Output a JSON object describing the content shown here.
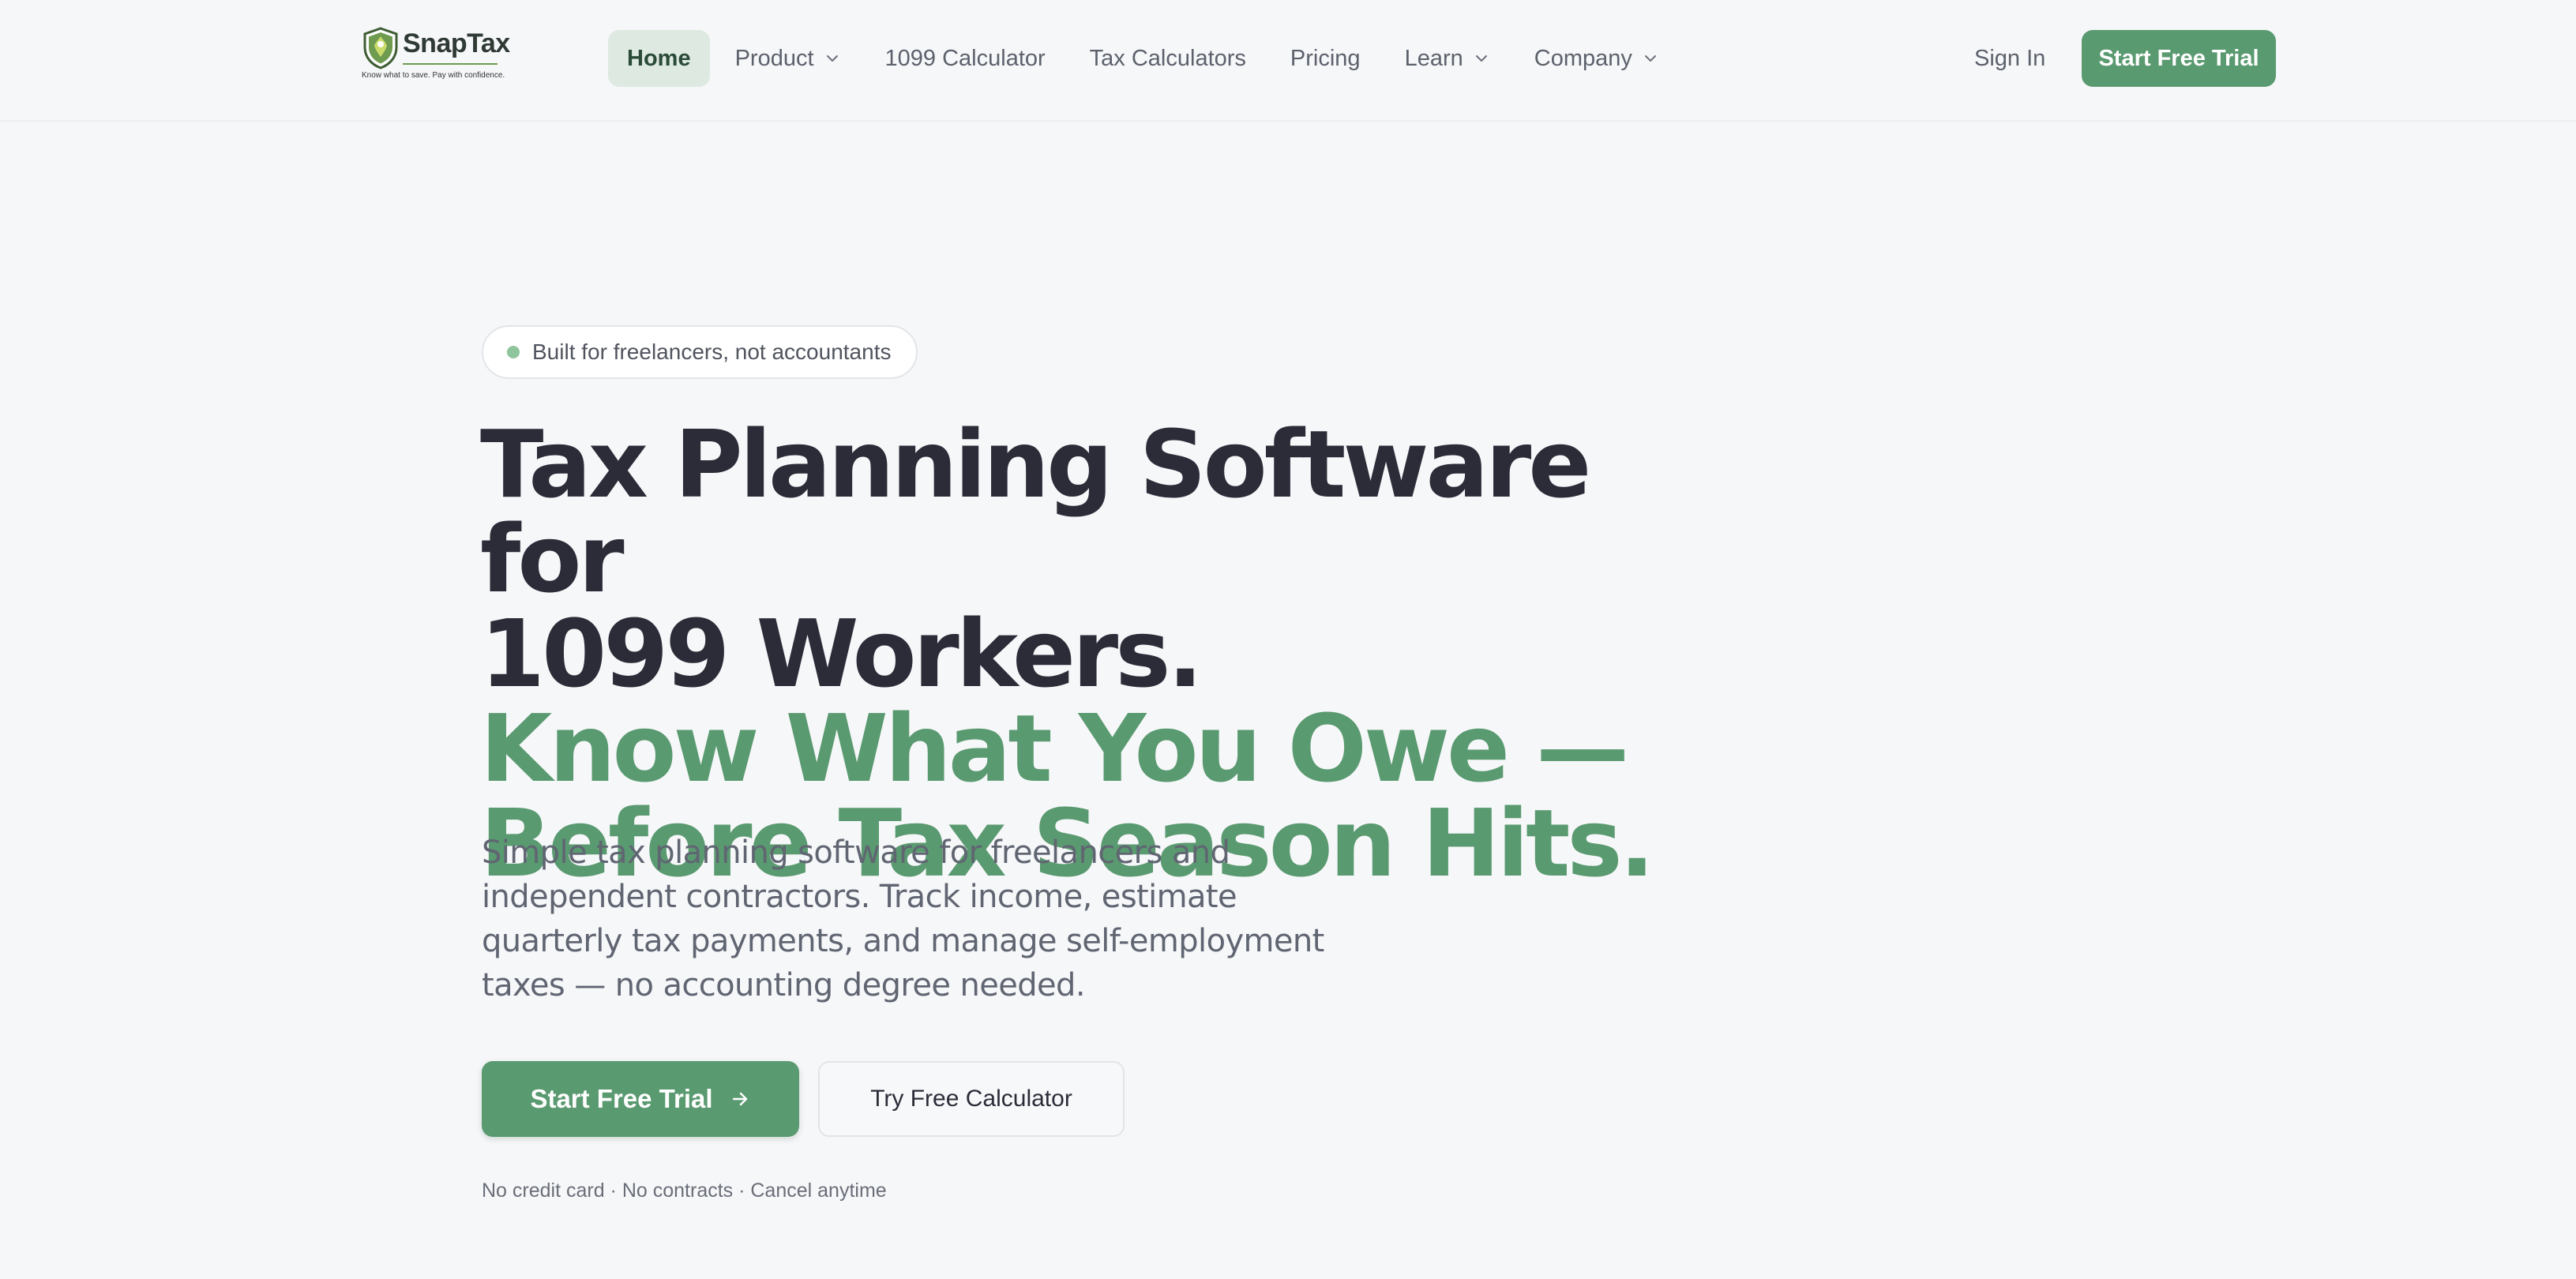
{
  "brand": {
    "name": "SnapTax",
    "tagline": "Know what to save. Pay with confidence.",
    "colors": {
      "accent": "#5a9a70",
      "accent_soft": "#dde9e1",
      "heading": "#2b2c38",
      "background": "#f6f7f9"
    }
  },
  "nav": {
    "items": [
      {
        "label": "Home",
        "active": true,
        "dropdown": false
      },
      {
        "label": "Product",
        "active": false,
        "dropdown": true
      },
      {
        "label": "1099 Calculator",
        "active": false,
        "dropdown": false
      },
      {
        "label": "Tax Calculators",
        "active": false,
        "dropdown": false
      },
      {
        "label": "Pricing",
        "active": false,
        "dropdown": false
      },
      {
        "label": "Learn",
        "active": false,
        "dropdown": true
      },
      {
        "label": "Company",
        "active": false,
        "dropdown": true
      }
    ],
    "sign_in": "Sign In",
    "cta": "Start Free Trial",
    "dropdown_icon": "chevron-down-icon"
  },
  "hero": {
    "badge": "Built for freelancers, not accountants",
    "headline_line1": "Tax Planning Software for",
    "headline_line2": "1099 Workers.",
    "headline_accent_line1": "Know What You Owe —",
    "headline_accent_line2": "Before Tax Season Hits.",
    "subtext": "Simple tax planning software for freelancers and independent contractors. Track income, estimate quarterly tax payments, and manage self-employment taxes — no accounting degree needed.",
    "primary_cta": "Start Free Trial",
    "primary_cta_icon": "arrow-right-icon",
    "secondary_cta": "Try Free Calculator",
    "fineprint": "No credit card · No contracts · Cancel anytime"
  }
}
